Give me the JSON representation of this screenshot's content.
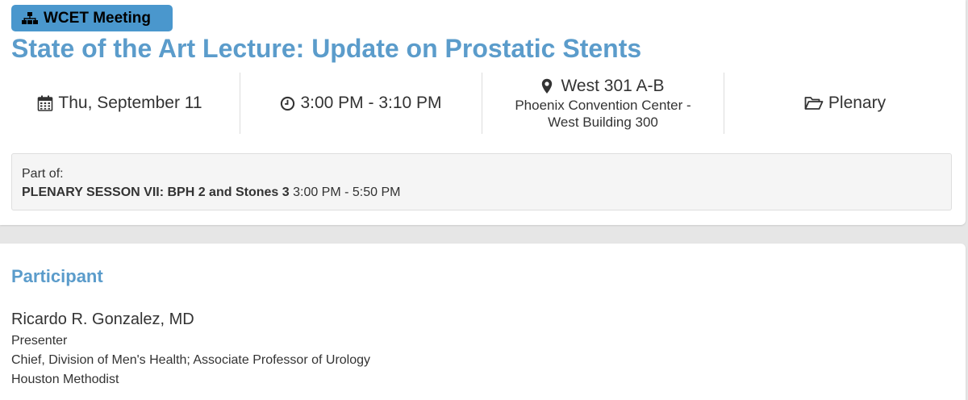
{
  "badge": {
    "label": "WCET Meeting",
    "icon": "sitemap-icon"
  },
  "title": "State of the Art Lecture: Update on Prostatic Stents",
  "info": {
    "date": {
      "icon": "calendar-icon",
      "text": "Thu, September 11"
    },
    "time": {
      "icon": "clock-icon",
      "text": "3:00 PM - 3:10 PM"
    },
    "location": {
      "icon": "map-marker-icon",
      "room": "West 301 A-B",
      "venue_line1": "Phoenix Convention Center -",
      "venue_line2": "West Building 300"
    },
    "session_type": {
      "icon": "folder-open-icon",
      "text": "Plenary"
    }
  },
  "part_of": {
    "label": "Part of:",
    "session_name": "PLENARY SESSON VII: BPH 2 and Stones 3",
    "session_time": "3:00 PM - 5:50 PM"
  },
  "participants": {
    "heading": "Participant",
    "items": [
      {
        "name": "Ricardo R. Gonzalez, MD",
        "role": "Presenter",
        "position": "Chief, Division of Men's Health; Associate Professor of Urology",
        "institution": "Houston Methodist"
      }
    ]
  },
  "colors": {
    "accent": "#5b9ccb",
    "badge_bg": "#4a97cd",
    "page_bg": "#e6e6e6"
  }
}
